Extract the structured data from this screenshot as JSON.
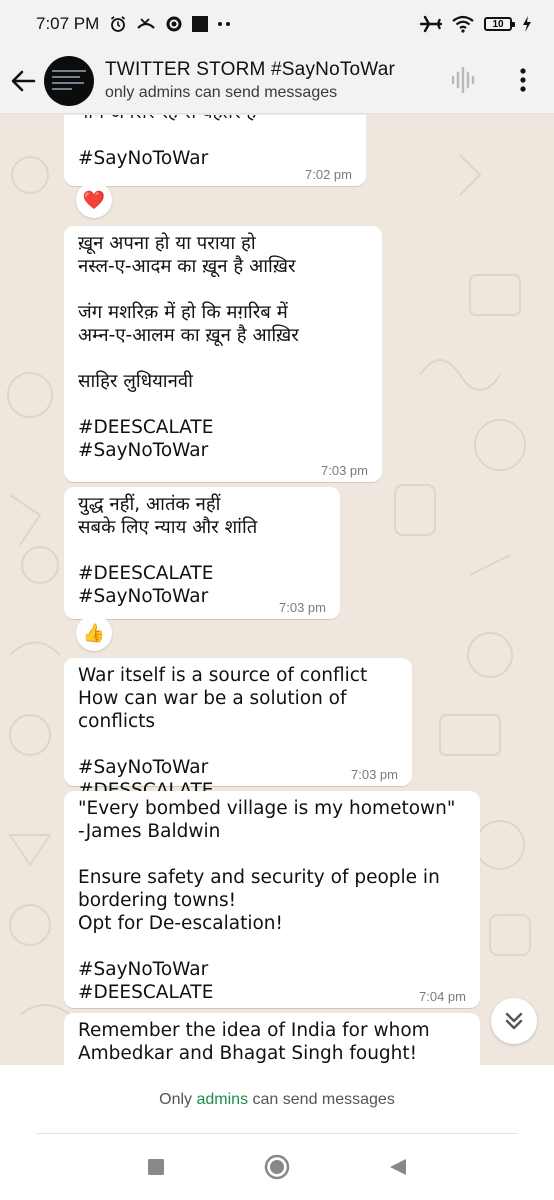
{
  "status_bar": {
    "time": "7:07 PM",
    "left_icons": [
      "alarm-icon",
      "missed-call-icon",
      "whatsapp-icon",
      "app-square-icon",
      "more-dots-icon"
    ],
    "right_icons": [
      "airplane-icon",
      "wifi-icon",
      "battery-icon",
      "charging-icon"
    ],
    "battery_level": "10"
  },
  "header": {
    "title": "TWITTER STORM #SayNoToWar",
    "subtitle": "only admins can send messages"
  },
  "messages": [
    {
      "text": "नाम अनसेर रहे से बहतर ह\n\n#SayNoToWar",
      "time": "7:02 pm",
      "reaction": "❤️"
    },
    {
      "text": "ख़ून अपना हो या पराया हो\nनस्ल-ए-आदम का ख़ून है आख़िर\n\nजंग मशरिक़ में हो कि मग़रिब में\nअम्न-ए-आलम का ख़ून है आख़िर\n\nसाहिर लुधियानवी\n\n#DEESCALATE\n#SayNoToWar",
      "time": "7:03 pm"
    },
    {
      "text": "युद्ध नहीं, आतंक नहीं\nसबके लिए न्याय और शांति\n\n#DEESCALATE\n#SayNoToWar",
      "time": "7:03 pm",
      "reaction": "👍"
    },
    {
      "text": "War itself is a source of conflict\nHow can war be a solution of conflicts\n\n#SayNoToWar\n#DESSCALATE",
      "time": "7:03 pm"
    },
    {
      "text": "\"Every bombed village is my hometown\"\n-James Baldwin\n\nEnsure safety and security of people in bordering towns!\nOpt for De-escalation!\n\n#SayNoToWar\n#DEESCALATE",
      "time": "7:04 pm"
    },
    {
      "text": "Remember the idea of India for whom\nAmbedkar and Bhagat Singh fought!"
    }
  ],
  "footer": {
    "prefix": "Only ",
    "link": "admins",
    "suffix": " can send messages"
  },
  "nav": [
    "recents-button",
    "home-button",
    "back-button"
  ],
  "colors": {
    "bubble": "#ffffff",
    "wallpaper": "#efe7dd",
    "link_green": "#1f8c4b"
  }
}
